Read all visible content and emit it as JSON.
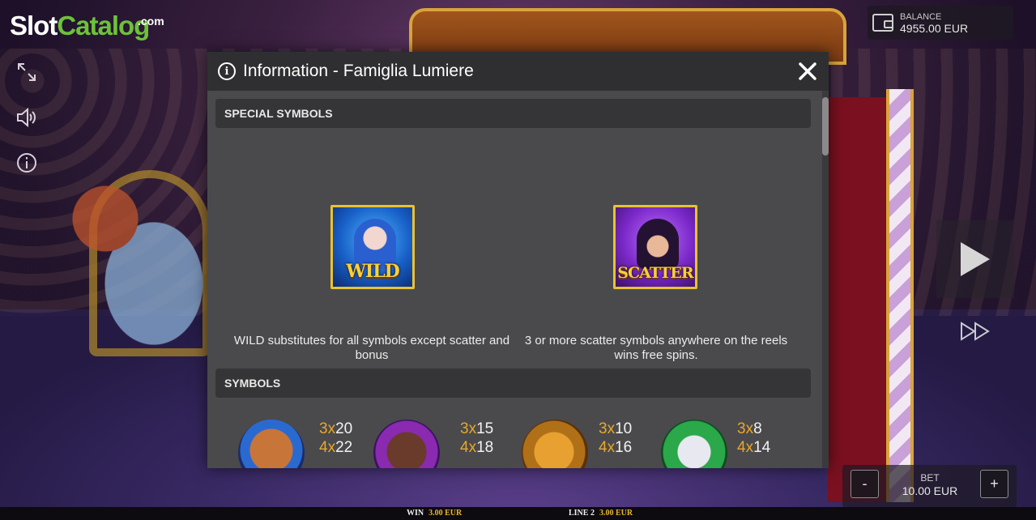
{
  "logo": {
    "part1": "Slot",
    "part2": "Catalog",
    "suffix": ".com"
  },
  "left_tools": {
    "icons": [
      "fullscreen-icon",
      "sound-icon",
      "info-icon"
    ]
  },
  "balance": {
    "label": "BALANCE",
    "value": "4955.00 EUR"
  },
  "bet": {
    "label": "BET",
    "value": "10.00 EUR",
    "minus": "-",
    "plus": "+"
  },
  "status_strip": {
    "win_label": "WIN",
    "win_value": "3.00 EUR",
    "line_label": "LINE 2",
    "line_value": "3.00 EUR"
  },
  "modal": {
    "title": "Information - Famiglia Lumiere",
    "special_section": "SPECIAL SYMBOLS",
    "special_symbols": [
      {
        "tile_text": "WILD",
        "description": "WILD substitutes for all symbols except scatter and bonus"
      },
      {
        "tile_text": "SCATTER",
        "description": "3 or more scatter symbols anywhere on the reels wins free spins."
      }
    ],
    "symbols_section": "SYMBOLS",
    "symbols": [
      {
        "name": "bear-icon",
        "pays": [
          {
            "mult": "3x",
            "value": "20"
          },
          {
            "mult": "4x",
            "value": "22"
          }
        ]
      },
      {
        "name": "monkey-icon",
        "pays": [
          {
            "mult": "3x",
            "value": "15"
          },
          {
            "mult": "4x",
            "value": "18"
          }
        ]
      },
      {
        "name": "tiger-icon",
        "pays": [
          {
            "mult": "3x",
            "value": "10"
          },
          {
            "mult": "4x",
            "value": "16"
          }
        ]
      },
      {
        "name": "rabbit-icon",
        "pays": [
          {
            "mult": "3x",
            "value": "8"
          },
          {
            "mult": "4x",
            "value": "14"
          }
        ]
      }
    ]
  },
  "colors": {
    "modal_bg": "#4a4a4c",
    "header_bg": "#2f2f31",
    "section_bg": "#353537",
    "tile_border": "#e8c232",
    "multiplier": "#e8a82a",
    "logo_green": "#6cc23a"
  }
}
